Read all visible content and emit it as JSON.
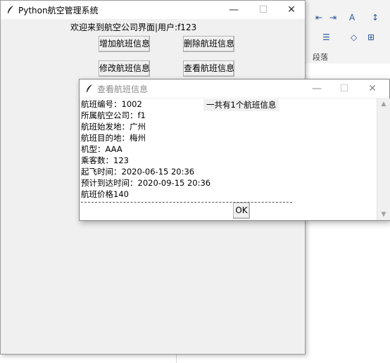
{
  "background_app": {
    "group_label": "段落",
    "tools_row1": [
      "⇤",
      "⇥",
      "A",
      "↕"
    ],
    "tools_row2": [
      "☰",
      "◇",
      "⊞"
    ]
  },
  "main_window": {
    "title": "Python航空管理系统",
    "controls": {
      "minimize": "—",
      "maximize": "☐",
      "close": "✕"
    },
    "welcome": "欢迎来到航空公司界面|用户:f123",
    "buttons": {
      "add": "增加航班信息",
      "delete": "删除航班信息",
      "modify": "修改航班信息",
      "view": "查看航班信息"
    }
  },
  "dialog": {
    "title": "查看航班信息",
    "controls": {
      "minimize": "—",
      "maximize": "☐",
      "close": "✕"
    },
    "count_label": "一共有1个航班信息",
    "lines": [
      "航班编号：1002",
      "所属航空公司：f1",
      "航班始发地：广州",
      "航班目的地：梅州",
      "机型：AAA",
      "乘客数：123",
      "起飞时间：2020-06-15 20:36",
      "预计到达时间：2020-09-15 20:36",
      "航班价格140"
    ],
    "ok_label": "OK",
    "scroll_up": "▲",
    "scroll_down": "▼"
  }
}
